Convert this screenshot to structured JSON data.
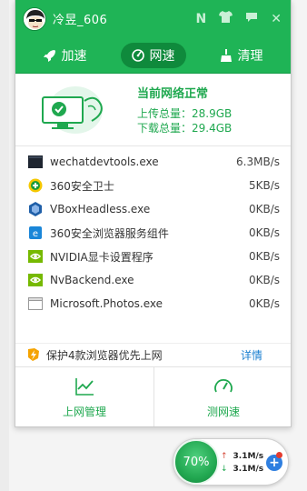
{
  "user": {
    "name": "冷昱_606"
  },
  "titlebar": {
    "icons": [
      "N",
      "shirt-icon",
      "chat-icon",
      "close-icon"
    ],
    "n_label": "N",
    "close_label": "✕"
  },
  "tabs": [
    {
      "label": "加速",
      "icon": "rocket-icon"
    },
    {
      "label": "网速",
      "icon": "speedometer-icon",
      "active": true
    },
    {
      "label": "清理",
      "icon": "broom-icon"
    }
  ],
  "status": {
    "title": "当前网络正常",
    "upload": "上传总量：28.9GB",
    "download": "下载总量：29.4GB"
  },
  "processes": [
    {
      "name": "wechatdevtools.exe",
      "speed": "6.3MB/s",
      "icon": "terminal-icon"
    },
    {
      "name": "360安全卫士",
      "speed": "5KB/s",
      "icon": "360-shield-icon"
    },
    {
      "name": "VBoxHeadless.exe",
      "speed": "0KB/s",
      "icon": "virtualbox-icon"
    },
    {
      "name": "360安全浏览器服务组件",
      "speed": "0KB/s",
      "icon": "360-browser-icon"
    },
    {
      "name": "NVIDIA显卡设置程序",
      "speed": "0KB/s",
      "icon": "nvidia-icon"
    },
    {
      "name": "NvBackend.exe",
      "speed": "0KB/s",
      "icon": "nvidia-icon"
    },
    {
      "name": "Microsoft.Photos.exe",
      "speed": "0KB/s",
      "icon": "window-icon"
    }
  ],
  "protect": {
    "text": "保护4款浏览器优先上网",
    "link": "详情"
  },
  "bottom": {
    "manage": "上网管理",
    "speedtest": "测网速"
  },
  "floatball": {
    "percent": "70%",
    "up": "3.1M/s",
    "down": "3.1M/s",
    "plus": "+"
  },
  "colors": {
    "brand_green": "#1fb456",
    "dark_green": "#0f8a3c",
    "link_blue": "#1a7fd0"
  }
}
